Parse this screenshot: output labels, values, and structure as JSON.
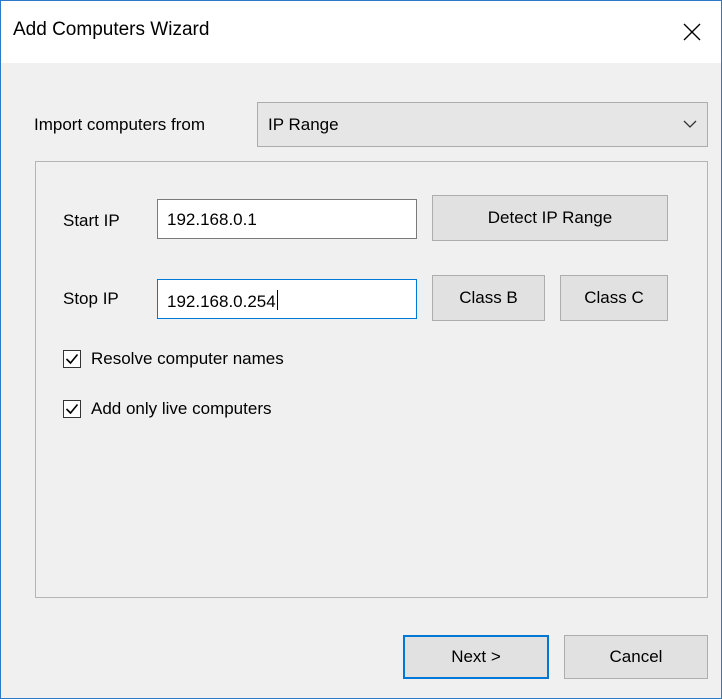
{
  "window": {
    "title": "Add Computers Wizard"
  },
  "import": {
    "label": "Import computers from",
    "selected": "IP Range"
  },
  "start_ip": {
    "label": "Start IP",
    "value": "192.168.0.1"
  },
  "stop_ip": {
    "label": "Stop IP",
    "value": "192.168.0.254"
  },
  "buttons": {
    "detect_ip_range": "Detect IP Range",
    "class_b": "Class B",
    "class_c": "Class C",
    "next": "Next >",
    "cancel": "Cancel"
  },
  "options": {
    "resolve_names": {
      "label": "Resolve computer names",
      "checked": true
    },
    "live_only": {
      "label": "Add only live computers",
      "checked": true
    }
  },
  "icons": {
    "close": "close-icon",
    "dropdown": "chevron-down-icon",
    "checkmark": "checkmark-icon"
  },
  "colors": {
    "accent": "#0078d7",
    "window_border": "#2b79c8",
    "dialog_background": "#f0f0f0"
  }
}
